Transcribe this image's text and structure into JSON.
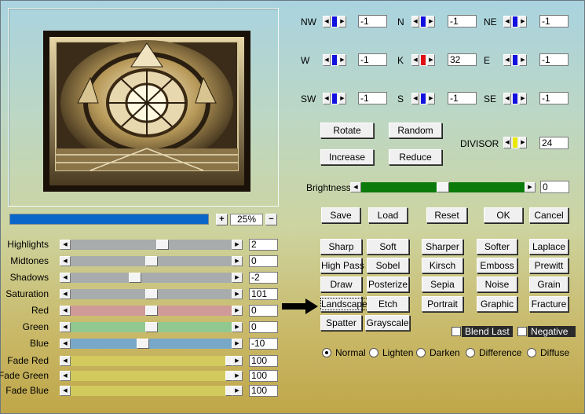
{
  "preview": {
    "label": "preview-image"
  },
  "progress": {
    "fill_fraction": 1.0
  },
  "zoom": {
    "plus": "+",
    "minus": "−",
    "value": "25%"
  },
  "sliders": [
    {
      "label": "Highlights",
      "value": "2",
      "thumb": 0.57,
      "color": "#a8acac"
    },
    {
      "label": "Midtones",
      "value": "0",
      "thumb": 0.5,
      "color": "#a8acac"
    },
    {
      "label": "Shadows",
      "value": "-2",
      "thumb": 0.4,
      "color": "#a8acac"
    },
    {
      "label": "Saturation",
      "value": "101",
      "thumb": 0.5,
      "color": "#a8acac"
    },
    {
      "label": "Red",
      "value": "0",
      "thumb": 0.5,
      "color": "#d09a98"
    },
    {
      "label": "Green",
      "value": "0",
      "thumb": 0.5,
      "color": "#90c890"
    },
    {
      "label": "Blue",
      "value": "-10",
      "thumb": 0.45,
      "color": "#78a8c8"
    },
    {
      "label": "Fade Red",
      "value": "100",
      "thumb": 1.0,
      "color": "#d2ca5c"
    },
    {
      "label": "Fade Green",
      "value": "100",
      "thumb": 1.0,
      "color": "#d2ca5c"
    },
    {
      "label": "Fade Blue",
      "value": "100",
      "thumb": 1.0,
      "color": "#d2ca5c"
    }
  ],
  "directions": [
    {
      "label": "NW",
      "value": "-1",
      "mark": "#1010e0"
    },
    {
      "label": "N",
      "value": "-1",
      "mark": "#1010e0"
    },
    {
      "label": "NE",
      "value": "-1",
      "mark": "#1010e0"
    },
    {
      "label": "W",
      "value": "-1",
      "mark": "#1010e0"
    },
    {
      "label": "K",
      "value": "32",
      "mark": "#e01010"
    },
    {
      "label": "E",
      "value": "-1",
      "mark": "#1010e0"
    },
    {
      "label": "SW",
      "value": "-1",
      "mark": "#1010e0"
    },
    {
      "label": "S",
      "value": "-1",
      "mark": "#1010e0"
    },
    {
      "label": "SE",
      "value": "-1",
      "mark": "#1010e0"
    }
  ],
  "divisor": {
    "label": "DIVISOR",
    "value": "24",
    "mark": "#e8e800"
  },
  "actions": {
    "rotate": "Rotate",
    "random": "Random",
    "increase": "Increase",
    "reduce": "Reduce"
  },
  "brightness": {
    "label": "Brightness",
    "value": "0",
    "level": 0.5
  },
  "dialog": {
    "save": "Save",
    "load": "Load",
    "reset": "Reset",
    "ok": "OK",
    "cancel": "Cancel"
  },
  "presets": [
    "Sharp",
    "Soft",
    "Sharper",
    "Softer",
    "Laplace",
    "High Pass",
    "Sobel",
    "Kirsch",
    "Emboss",
    "Prewitt",
    "Draw",
    "Posterize",
    "Sepia",
    "Noise",
    "Grain",
    "Landscape",
    "Etch",
    "Portrait",
    "Graphic",
    "Fracture",
    "Spatter",
    "Grayscale"
  ],
  "options": {
    "blend_last": "Blend Last",
    "negative": "Negative"
  },
  "modes": [
    "Normal",
    "Lighten",
    "Darken",
    "Difference",
    "Diffuse"
  ],
  "selected_mode": "Normal"
}
